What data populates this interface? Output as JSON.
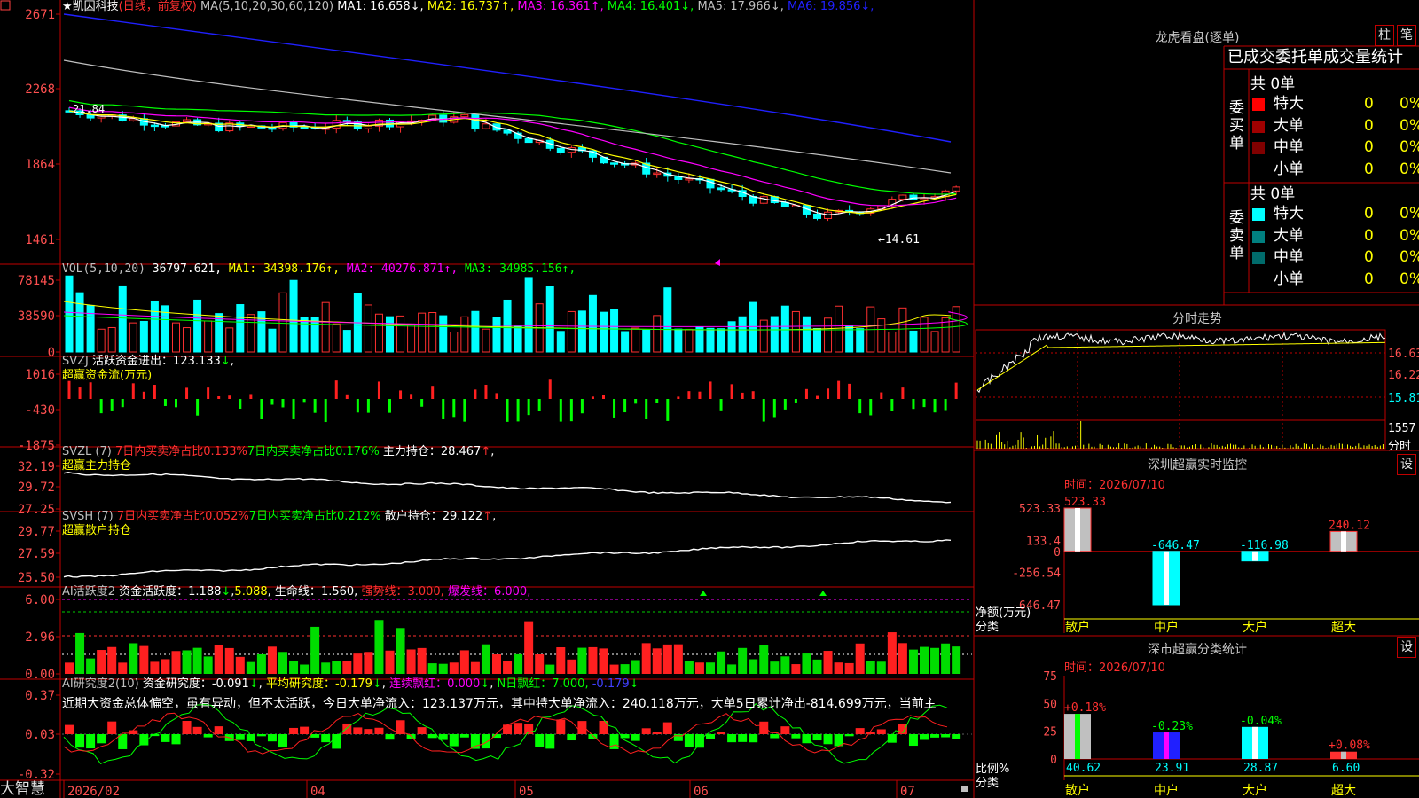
{
  "app": {
    "brand": "大智慧"
  },
  "main": {
    "stock": "★凯因科技",
    "period": "(日线，前复权)",
    "ma_label": "MA(5,10,20,30,60,120)",
    "ma": [
      {
        "name": "MA1",
        "value": "16.658",
        "arrow": "↓",
        "color": "#ffffff"
      },
      {
        "name": "MA2",
        "value": "16.737",
        "arrow": "↑",
        "color": "#ffff00"
      },
      {
        "name": "MA3",
        "value": "16.361",
        "arrow": "↑",
        "color": "#ff00ff"
      },
      {
        "name": "MA4",
        "value": "16.401",
        "arrow": "↓",
        "color": "#00ff00"
      },
      {
        "name": "MA5",
        "value": "17.966",
        "arrow": "↓",
        "color": "#c0c0c0"
      },
      {
        "name": "MA6",
        "value": "19.856",
        "arrow": "↓",
        "color": "#2020ff"
      }
    ],
    "y_labels": [
      "2671",
      "2268",
      "1864",
      "1461"
    ],
    "high_mark": "21.84",
    "low_mark": "←14.61"
  },
  "vol": {
    "label": "VOL(5,10,20)",
    "value": "36797.621",
    "ma": [
      {
        "name": "MA1",
        "value": "34398.176",
        "arrow": "↑",
        "color": "#ffff00"
      },
      {
        "name": "MA2",
        "value": "40276.871",
        "arrow": "↑",
        "color": "#ff00ff"
      },
      {
        "name": "MA3",
        "value": "34985.156",
        "arrow": "↑",
        "color": "#00ff00"
      }
    ],
    "y_labels": [
      "78145",
      "38590",
      "0"
    ]
  },
  "svzj": {
    "label": "SVZJ",
    "t1": "活跃资金进出：",
    "v1": "123.133",
    "a1": "↓",
    "t2": "超赢资金流(万元)",
    "y_labels": [
      "1016",
      "-430",
      "-1875"
    ]
  },
  "svzl": {
    "label": "SVZL (7)",
    "t1": "7日内买卖净占比0.133%",
    "t2": "7日内买卖净占比0.176%",
    "t3": "主力持仓：",
    "v3": "28.467",
    "a3": "↑",
    "sep": ",",
    "t4": "超赢主力持仓",
    "y_labels": [
      "32.19",
      "29.72",
      "27.25"
    ]
  },
  "svsh": {
    "label": "SVSH (7)",
    "t1": "7日内买卖净占比0.052%",
    "t2": "7日内买卖净占比0.212%",
    "t3": "散户持仓：",
    "v3": "29.122",
    "a3": "↑",
    "sep": ",",
    "t4": "超赢散户持仓",
    "y_labels": [
      "29.77",
      "27.59",
      "25.50"
    ]
  },
  "ai1": {
    "label": "AI活跃度2",
    "t1": "资金活跃度：",
    "v1": "1.188",
    "a1": "↓",
    "v2": "5.088",
    "t3": "生命线：",
    "v3": "1.560",
    "t4": "强势线：",
    "v4": "3.000",
    "t5": "爆发线：",
    "v5": "6.000",
    "y_labels": [
      "6.00",
      "2.96",
      "0.00"
    ]
  },
  "ai2": {
    "label": "AI研究度2(10)",
    "t1": "资金研究度：",
    "v1": "-0.091",
    "a1": "↓",
    "t2": "平均研究度：",
    "v2": "-0.179",
    "a2": "↓",
    "t3": "连续飘红：",
    "v3": "0.000",
    "a3": "↓",
    "t4": "N日飘红：",
    "v4": "7.000",
    "v4b": "-0.179",
    "a4": "↓",
    "desc": "近期大资金总体偏空，虽有异动，但不太活跃，今日大单净流入：123.137万元，其中特大单净流入：240.118万元，大单5日累计净出-814.699万元，当前主",
    "y_labels": [
      "0.37",
      "0.03",
      "-0.32"
    ]
  },
  "xaxis": {
    "labels": [
      "2026/02",
      "04",
      "05",
      "06",
      "07"
    ]
  },
  "lhb": {
    "title": "龙虎看盘(逐单)",
    "btn1": "柱",
    "btn2": "笔",
    "subtitle": "已成交委托单成交量统计",
    "buy_label": "委买单",
    "sell_label": "委卖单",
    "buy_total": "共 0单",
    "sell_total": "共 0单",
    "buy_rows": [
      {
        "name": "特大",
        "count": "0",
        "pct": "0%",
        "color": "#ff0000"
      },
      {
        "name": "大单",
        "count": "0",
        "pct": "0%",
        "color": "#a00000"
      },
      {
        "name": "中单",
        "count": "0",
        "pct": "0%",
        "color": "#800000"
      },
      {
        "name": "小单",
        "count": "0",
        "pct": "0%",
        "color": "#000000"
      }
    ],
    "sell_rows": [
      {
        "name": "特大",
        "count": "0",
        "pct": "0%",
        "color": "#00ffff"
      },
      {
        "name": "大单",
        "count": "0",
        "pct": "0%",
        "color": "#008080"
      },
      {
        "name": "中单",
        "count": "0",
        "pct": "0%",
        "color": "#006b6b"
      },
      {
        "name": "小单",
        "count": "0",
        "pct": "0%",
        "color": "#000000"
      }
    ]
  },
  "fenshi": {
    "title": "分时走势",
    "labels": [
      "16.63",
      "16.22",
      "15.81",
      "1557",
      "分时"
    ]
  },
  "monitor": {
    "title": "深圳超赢实时监控",
    "btn": "设",
    "time": "时间：2026/07/10",
    "y_labels": [
      "523.33",
      "133.4",
      "0",
      "-256.54",
      "-646.47"
    ],
    "unit1": "净额(万元)",
    "unit2": "分类",
    "chart_data": {
      "type": "bar",
      "categories": [
        "散户",
        "中户",
        "大户",
        "超大"
      ],
      "values": [
        523.33,
        -646.47,
        -116.98,
        240.12
      ],
      "value_labels": [
        "523.33",
        "-646.47",
        "-116.98",
        "240.12"
      ],
      "ylim": [
        -646.47,
        523.33
      ]
    }
  },
  "classify": {
    "title": "深市超赢分类统计",
    "btn": "设",
    "time": "时间：2026/07/10",
    "y_labels": [
      "75",
      "50",
      "25",
      "0"
    ],
    "unit1": "比例%",
    "unit2": "分类",
    "chart_data": {
      "type": "bar",
      "categories": [
        "散户",
        "中户",
        "大户",
        "超大"
      ],
      "values": [
        40.62,
        23.91,
        28.87,
        6.6
      ],
      "value_labels": [
        "40.62",
        "23.91",
        "28.87",
        "6.60"
      ],
      "change_labels": [
        "+0.18%",
        "-0.23%",
        "-0.04%",
        "+0.08%"
      ],
      "ylim": [
        0,
        75
      ]
    }
  }
}
